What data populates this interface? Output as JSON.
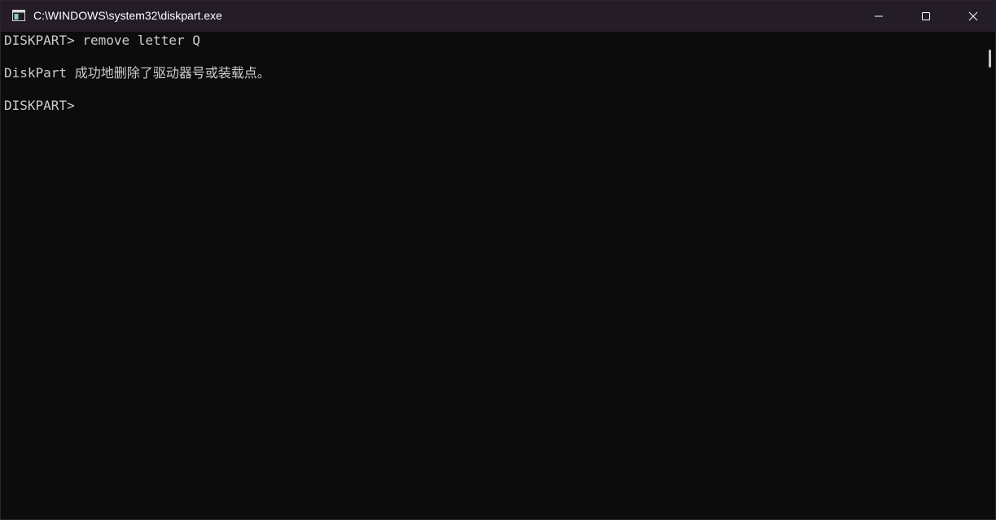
{
  "window": {
    "title": "C:\\WINDOWS\\system32\\diskpart.exe",
    "app_icon": "console-icon"
  },
  "caption_buttons": {
    "minimize_icon": "minimize-icon",
    "maximize_icon": "maximize-icon",
    "close_icon": "close-icon"
  },
  "console": {
    "lines": [
      "DISKPART> remove letter Q",
      "DiskPart 成功地删除了驱动器号或装载点。",
      "DISKPART>"
    ]
  },
  "colors": {
    "background": "#0c0c0c",
    "titlebar": "#241c27",
    "text": "#cccccc",
    "title_text": "#ffffff"
  }
}
